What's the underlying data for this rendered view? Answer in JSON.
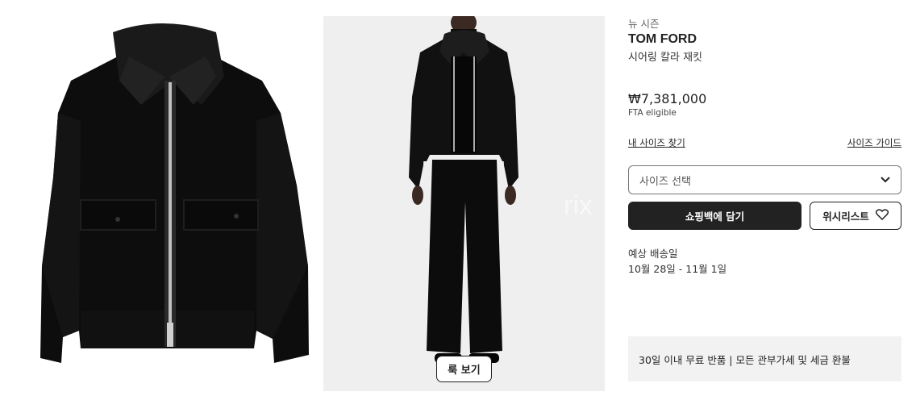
{
  "product": {
    "season_label": "뉴 시즌",
    "brand": "TOM FORD",
    "name": "시어링 칼라 재킷",
    "price": "₩7,381,000",
    "price_note": "FTA eligible"
  },
  "size": {
    "find_my_size_link": "내 사이즈 찾기",
    "size_guide_link": "사이즈 가이드",
    "select_placeholder": "사이즈 선택"
  },
  "actions": {
    "add_to_bag": "쇼핑백에 담기",
    "wishlist": "위시리스트"
  },
  "shipping": {
    "label": "예상 배송일",
    "dates": "10월 28일 - 11월 1일"
  },
  "returns_banner": "30일 이내 무료 반품 | 모든 관부가세 및 세금 환불",
  "gallery": {
    "look_button": "룩 보기",
    "watermark": "rix"
  },
  "icons": {
    "chevron": "chevron-down-icon",
    "heart": "heart-icon"
  }
}
